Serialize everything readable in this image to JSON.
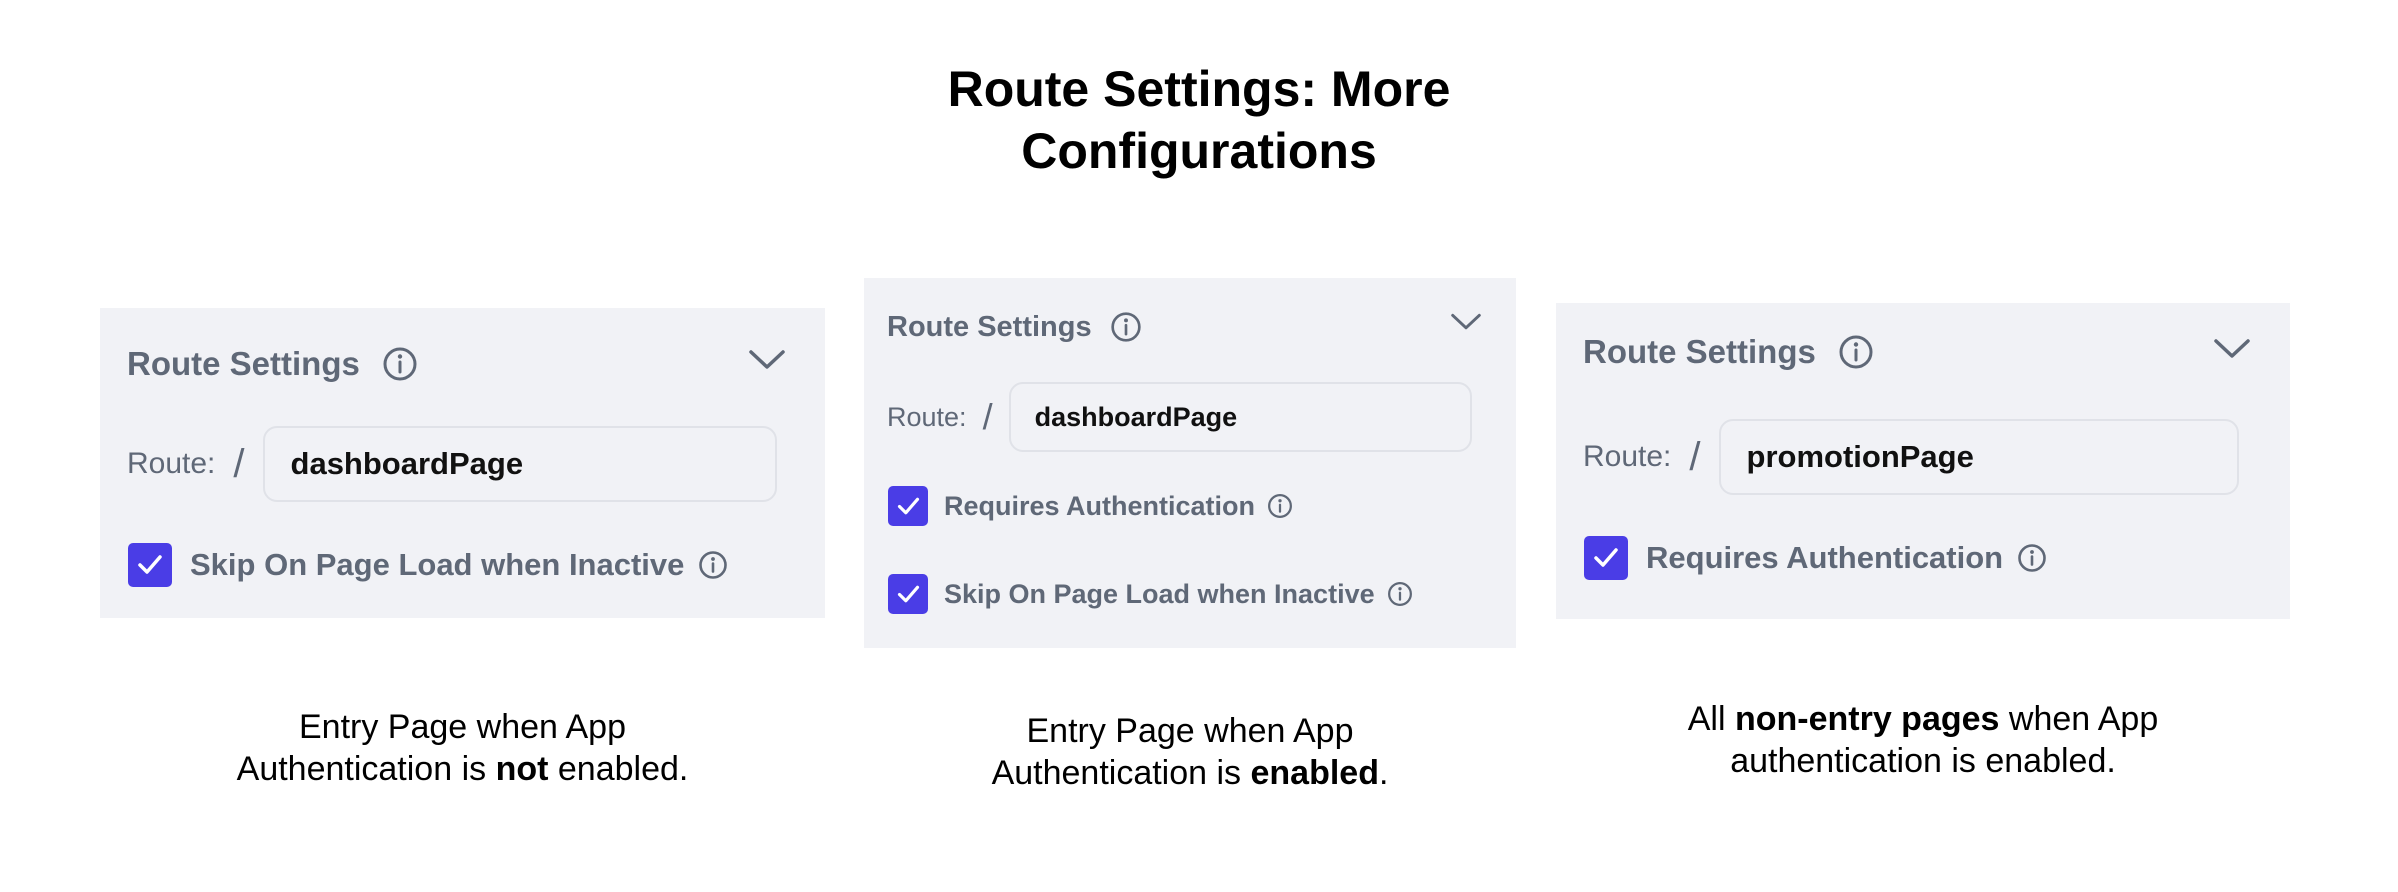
{
  "page": {
    "title_line1": "Route Settings: More",
    "title_line2": "Configurations"
  },
  "panels": [
    {
      "header": "Route Settings",
      "route_label": "Route:",
      "slash": "/",
      "route_value": "dashboardPage",
      "checks": [
        {
          "label": "Skip On Page Load when Inactive",
          "checked": true
        }
      ],
      "caption": {
        "line1": "Entry Page when App",
        "line2_pre": "Authentication is ",
        "line2_bold": "not",
        "line2_post": " enabled."
      }
    },
    {
      "header": "Route Settings",
      "route_label": "Route:",
      "slash": "/",
      "route_value": "dashboardPage",
      "checks": [
        {
          "label": "Requires Authentication",
          "checked": true
        },
        {
          "label": "Skip On Page Load when Inactive",
          "checked": true
        }
      ],
      "caption": {
        "line1": "Entry Page when App",
        "line2_pre": "Authentication is ",
        "line2_bold": "enabled",
        "line2_post": "."
      }
    },
    {
      "header": "Route Settings",
      "route_label": "Route:",
      "slash": "/",
      "route_value": "promotionPage",
      "checks": [
        {
          "label": "Requires Authentication",
          "checked": true
        }
      ],
      "caption": {
        "line1_pre": "All ",
        "line1_bold": "non-entry pages",
        "line1_post": " when App",
        "line2": "authentication is enabled."
      }
    }
  ],
  "colors": {
    "panel_bg": "#f1f2f6",
    "checkbox": "#4a3de6",
    "label_gray": "#5f6877"
  },
  "icons": {
    "info": "info-circle-icon",
    "chevron": "chevron-down-icon",
    "check": "checkmark-icon"
  }
}
